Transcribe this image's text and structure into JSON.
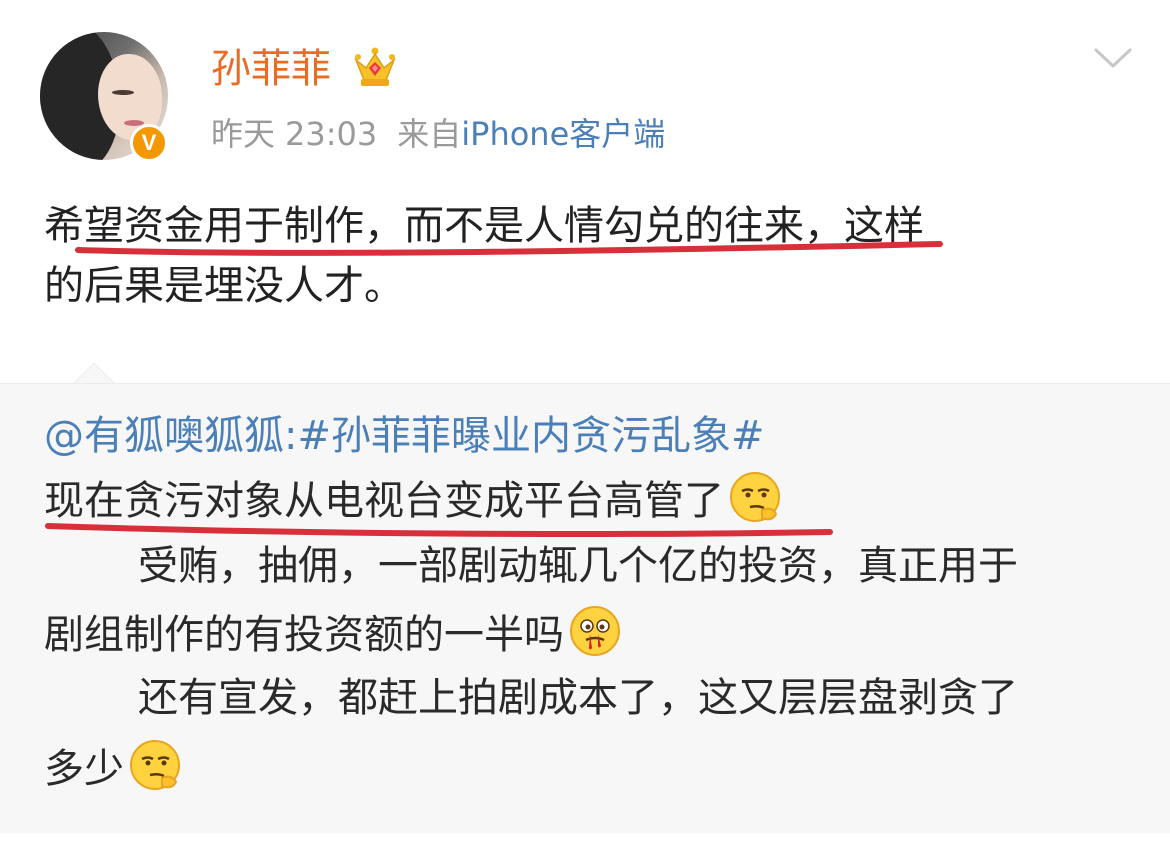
{
  "user": {
    "name": "孙菲菲",
    "verified_badge": "V",
    "crown_icon": "crown-icon"
  },
  "meta": {
    "day": "昨天",
    "time": "23:03",
    "source_prefix": "来自",
    "client": "iPhone客户端"
  },
  "post": {
    "line1": "希望资金用于制作，而不是人情勾兑的往来，这样",
    "line2": "的后果是埋没人才。"
  },
  "repost": {
    "author": "@有狐噢狐狐",
    "colon": ":",
    "topic": "#孙菲菲曝业内贪污乱象#",
    "line1": "现在贪污对象从电视台变成平台高管了",
    "line2": "受贿，抽佣，一部剧动辄几个亿的投资，真正用于",
    "line3": "剧组制作的有投资额的一半吗",
    "line4": "还有宣发，都赶上拍剧成本了，这又层层盘剥贪了",
    "line5": "多少"
  },
  "colors": {
    "username": "#e86c24",
    "link": "#4b7fb8",
    "meta": "#9a9a9a",
    "underline": "#d8303b",
    "repost_bg": "#f7f7f7"
  }
}
